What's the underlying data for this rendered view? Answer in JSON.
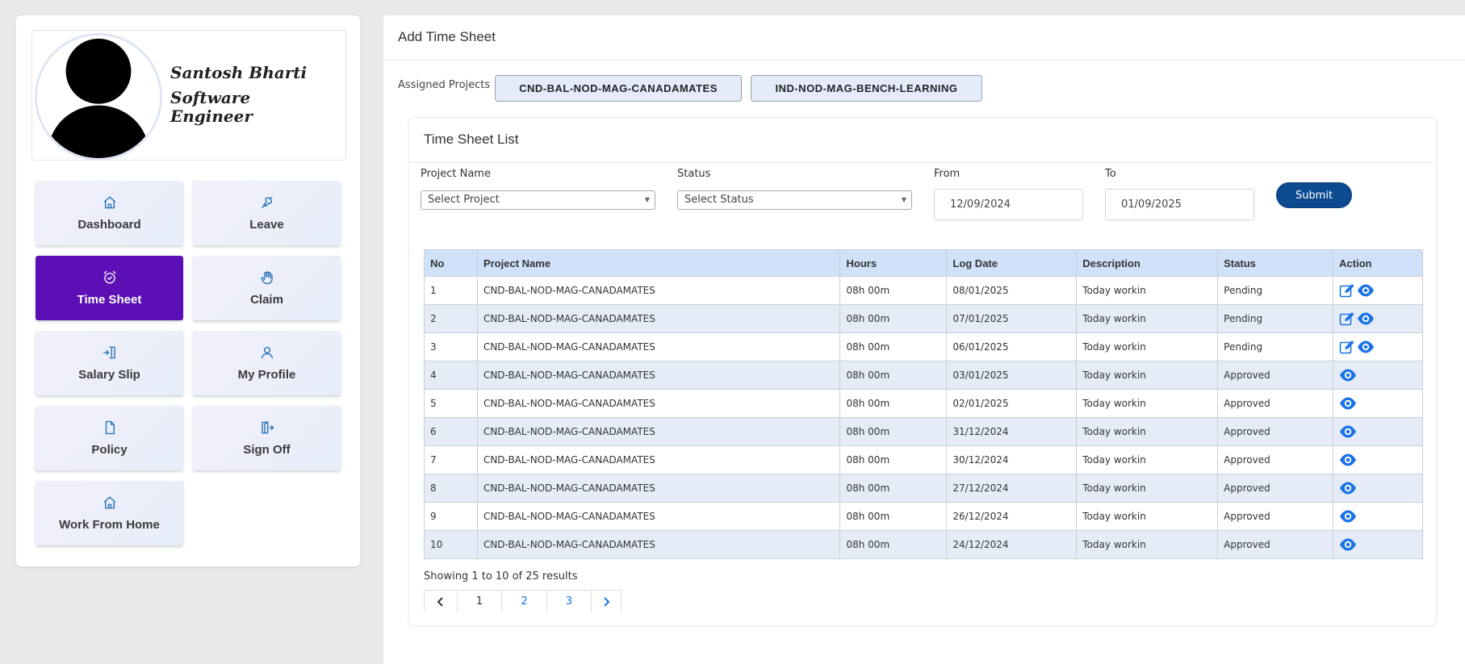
{
  "profile": {
    "name": "Santosh Bharti",
    "role": "Software Engineer"
  },
  "nav": [
    {
      "label": "Dashboard",
      "icon": "home-icon"
    },
    {
      "label": "Leave",
      "icon": "leave-icon"
    },
    {
      "label": "Time Sheet",
      "icon": "alarm-clock-icon",
      "active": true
    },
    {
      "label": "Claim",
      "icon": "hand-icon"
    },
    {
      "label": "Salary Slip",
      "icon": "wallet-icon"
    },
    {
      "label": "My Profile",
      "icon": "user-icon"
    },
    {
      "label": "Policy",
      "icon": "document-icon"
    },
    {
      "label": "Sign Off",
      "icon": "sign-off-icon"
    },
    {
      "label": "Work From Home",
      "icon": "home-icon"
    }
  ],
  "main": {
    "title": "Add Time Sheet",
    "assigned_label": "Assigned Projects",
    "projects": [
      "CND-BAL-NOD-MAG-CANADAMATES",
      "IND-NOD-MAG-BENCH-LEARNING"
    ]
  },
  "timesheet": {
    "title": "Time Sheet List",
    "filters": {
      "project_label": "Project Name",
      "project_value": "Select Project",
      "status_label": "Status",
      "status_value": "Select Status",
      "from_label": "From",
      "from_value": "12/09/2024",
      "to_label": "To",
      "to_value": "01/09/2025",
      "submit_label": "Submit"
    },
    "columns": [
      "No",
      "Project Name",
      "Hours",
      "Log Date",
      "Description",
      "Status",
      "Action"
    ],
    "rows": [
      {
        "no": "1",
        "project": "CND-BAL-NOD-MAG-CANADAMATES",
        "hours": "08h 00m",
        "date": "08/01/2025",
        "description": "Today workin",
        "status": "Pending",
        "editable": true
      },
      {
        "no": "2",
        "project": "CND-BAL-NOD-MAG-CANADAMATES",
        "hours": "08h 00m",
        "date": "07/01/2025",
        "description": "Today workin",
        "status": "Pending",
        "editable": true
      },
      {
        "no": "3",
        "project": "CND-BAL-NOD-MAG-CANADAMATES",
        "hours": "08h 00m",
        "date": "06/01/2025",
        "description": "Today workin",
        "status": "Pending",
        "editable": true
      },
      {
        "no": "4",
        "project": "CND-BAL-NOD-MAG-CANADAMATES",
        "hours": "08h 00m",
        "date": "03/01/2025",
        "description": "Today workin",
        "status": "Approved",
        "editable": false
      },
      {
        "no": "5",
        "project": "CND-BAL-NOD-MAG-CANADAMATES",
        "hours": "08h 00m",
        "date": "02/01/2025",
        "description": "Today workin",
        "status": "Approved",
        "editable": false
      },
      {
        "no": "6",
        "project": "CND-BAL-NOD-MAG-CANADAMATES",
        "hours": "08h 00m",
        "date": "31/12/2024",
        "description": "Today workin",
        "status": "Approved",
        "editable": false
      },
      {
        "no": "7",
        "project": "CND-BAL-NOD-MAG-CANADAMATES",
        "hours": "08h 00m",
        "date": "30/12/2024",
        "description": "Today workin",
        "status": "Approved",
        "editable": false
      },
      {
        "no": "8",
        "project": "CND-BAL-NOD-MAG-CANADAMATES",
        "hours": "08h 00m",
        "date": "27/12/2024",
        "description": "Today workin",
        "status": "Approved",
        "editable": false
      },
      {
        "no": "9",
        "project": "CND-BAL-NOD-MAG-CANADAMATES",
        "hours": "08h 00m",
        "date": "26/12/2024",
        "description": "Today workin",
        "status": "Approved",
        "editable": false
      },
      {
        "no": "10",
        "project": "CND-BAL-NOD-MAG-CANADAMATES",
        "hours": "08h 00m",
        "date": "24/12/2024",
        "description": "Today workin",
        "status": "Approved",
        "editable": false
      }
    ],
    "results_text": "Showing 1 to 10 of 25 results",
    "pages": [
      "1",
      "2",
      "3"
    ],
    "current_page": "1"
  },
  "colors": {
    "active_nav": "#5b0fb5",
    "submit": "#0d4a90",
    "table_header": "#cfe2fa",
    "icon_blue": "#1a73e8"
  }
}
